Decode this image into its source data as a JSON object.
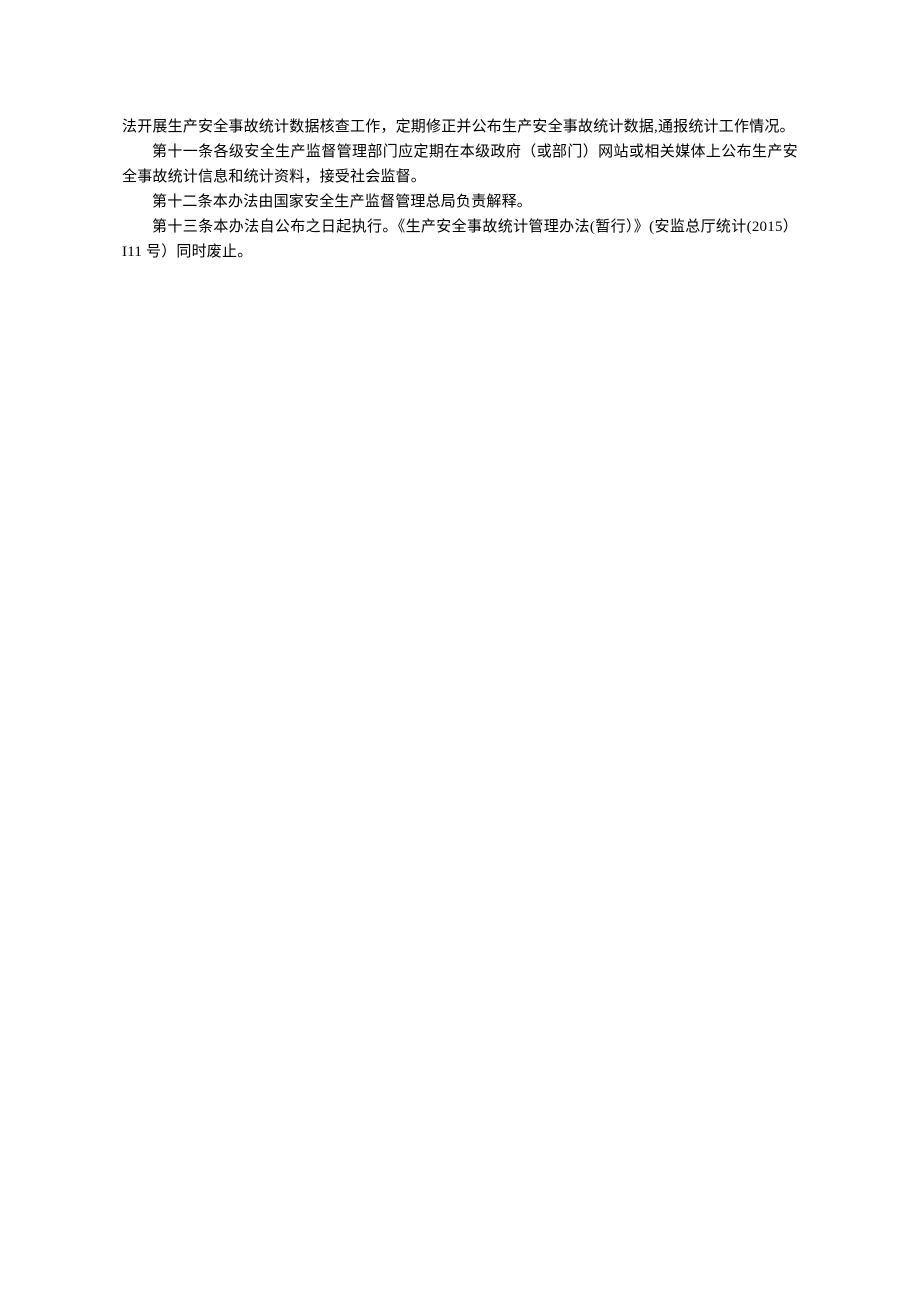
{
  "document": {
    "paragraphs": [
      {
        "indent": false,
        "text": "法开展生产安全事故统计数据核查工作，定期修正并公布生产安全事故统计数据,通报统计工作情况。"
      },
      {
        "indent": true,
        "text": "第十一条各级安全生产监督管理部门应定期在本级政府（或部门）网站或相关媒体上公布生产安全事故统计信息和统计资料，接受社会监督。"
      },
      {
        "indent": true,
        "text": "第十二条本办法由国家安全生产监督管理总局负责解释。"
      },
      {
        "indent": true,
        "text": "第十三条本办法自公布之日起执行。《生产安全事故统计管理办法(暂行）》(安监总厅统计(2015）I11 号）同时废止。"
      }
    ]
  }
}
